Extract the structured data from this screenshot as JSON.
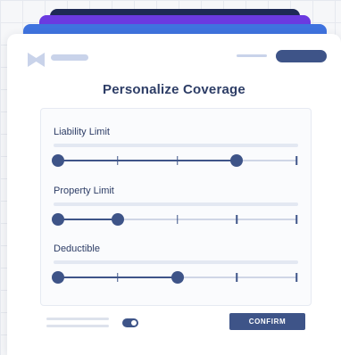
{
  "colors": {
    "stack_back": "#1e2a55",
    "stack_mid": "#6b3ae0",
    "stack_front": "#3f73df",
    "accent": "#3e5488",
    "title": "#2d3d66"
  },
  "header": {
    "logo_icon": "bowtie-logo-icon"
  },
  "card": {
    "title": "Personalize Coverage"
  },
  "sliders": [
    {
      "label": "Liability Limit",
      "steps": 5,
      "value_index": 3
    },
    {
      "label": "Property Limit",
      "steps": 5,
      "value_index": 1
    },
    {
      "label": "Deductible",
      "steps": 5,
      "value_index": 2
    }
  ],
  "footer": {
    "toggle_on": true,
    "confirm_label": "CONFIRM"
  }
}
